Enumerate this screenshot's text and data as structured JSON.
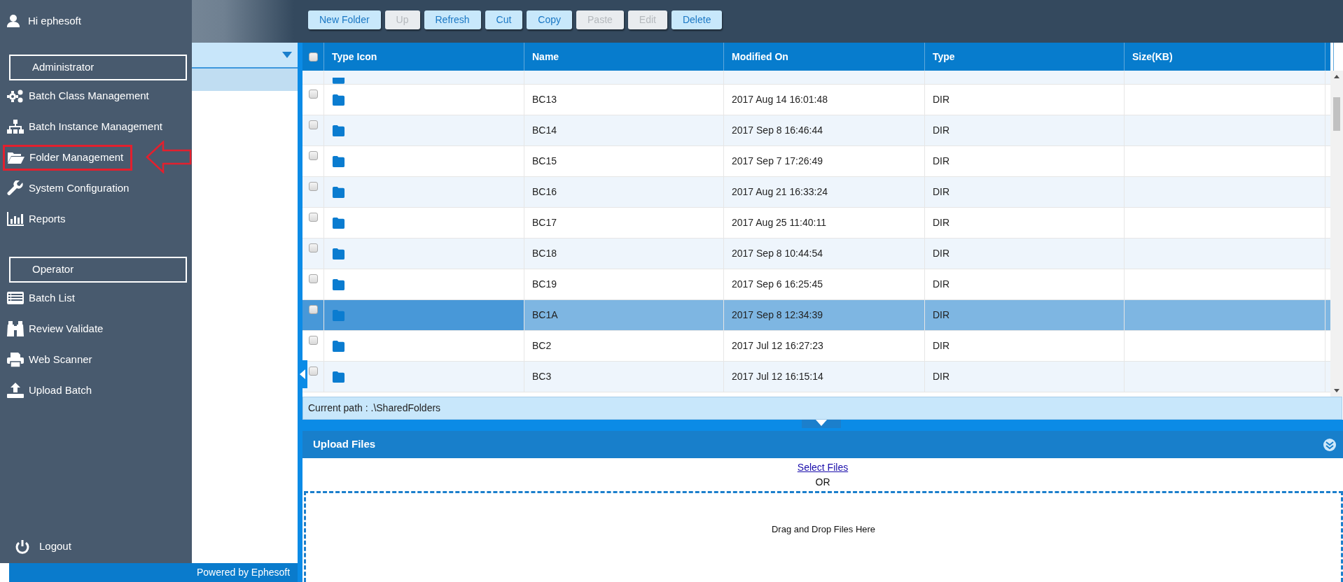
{
  "toolbar": {
    "buttons": [
      {
        "label": "New Folder",
        "disabled": false
      },
      {
        "label": "Up",
        "disabled": true
      },
      {
        "label": "Refresh",
        "disabled": false
      },
      {
        "label": "Cut",
        "disabled": false
      },
      {
        "label": "Copy",
        "disabled": false
      },
      {
        "label": "Paste",
        "disabled": true
      },
      {
        "label": "Edit",
        "disabled": true
      },
      {
        "label": "Delete",
        "disabled": false
      }
    ]
  },
  "tree": {
    "nodes": [
      {
        "selected": true
      }
    ]
  },
  "footer": "Powered by Ephesoft",
  "menu": {
    "greeting": "Hi ephesoft",
    "sections": [
      {
        "title": "Administrator",
        "items": [
          {
            "label": "Batch Class Management",
            "annotated": false
          },
          {
            "label": "Batch Instance Management",
            "annotated": false
          },
          {
            "label": "Folder Management",
            "annotated": true
          },
          {
            "label": "System Configuration",
            "annotated": false
          },
          {
            "label": "Reports",
            "annotated": false
          }
        ]
      },
      {
        "title": "Operator",
        "items": [
          {
            "label": "Batch List",
            "annotated": false
          },
          {
            "label": "Review Validate",
            "annotated": false
          },
          {
            "label": "Web Scanner",
            "annotated": false
          },
          {
            "label": "Upload Batch",
            "annotated": false
          }
        ]
      }
    ],
    "logout": "Logout"
  },
  "table": {
    "columns": [
      "Type Icon",
      "Name",
      "Modified On",
      "Type",
      "Size(KB)"
    ],
    "all_checked": false,
    "rows": [
      {
        "name": "BC13",
        "modified": "2017 Aug 14 16:01:48",
        "type": "DIR",
        "checked": false,
        "selected": false
      },
      {
        "name": "BC14",
        "modified": "2017 Sep 8 16:46:44",
        "type": "DIR",
        "checked": false,
        "selected": false
      },
      {
        "name": "BC15",
        "modified": "2017 Sep 7 17:26:49",
        "type": "DIR",
        "checked": false,
        "selected": false
      },
      {
        "name": "BC16",
        "modified": "2017 Aug 21 16:33:24",
        "type": "DIR",
        "checked": false,
        "selected": false
      },
      {
        "name": "BC17",
        "modified": "2017 Aug 25 11:40:11",
        "type": "DIR",
        "checked": false,
        "selected": false
      },
      {
        "name": "BC18",
        "modified": "2017 Sep 8 10:44:54",
        "type": "DIR",
        "checked": false,
        "selected": false
      },
      {
        "name": "BC19",
        "modified": "2017 Sep 6 16:25:45",
        "type": "DIR",
        "checked": false,
        "selected": false
      },
      {
        "name": "BC1A",
        "modified": "2017 Sep 8 12:34:39",
        "type": "DIR",
        "checked": false,
        "selected": true
      },
      {
        "name": "BC2",
        "modified": "2017 Jul 12 16:27:23",
        "type": "DIR",
        "checked": false,
        "selected": false
      },
      {
        "name": "BC3",
        "modified": "2017 Jul 12 16:15:14",
        "type": "DIR",
        "checked": false,
        "selected": false
      }
    ]
  },
  "current_path": "Current path : .\\SharedFolders",
  "upload": {
    "title": "Upload Files",
    "link": "Select Files",
    "separator": "OR",
    "drop_hint": "Drag and Drop Files Here"
  }
}
